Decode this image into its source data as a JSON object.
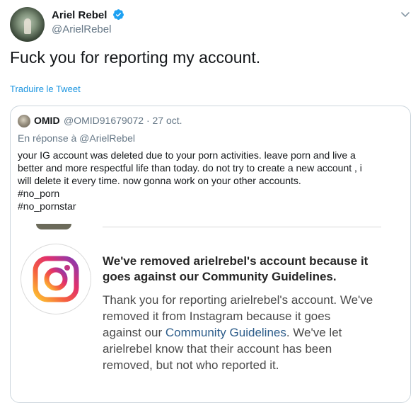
{
  "author": {
    "display_name": "Ariel Rebel",
    "handle": "@ArielRebel",
    "verified": true
  },
  "tweet": {
    "text": "Fuck you for reporting my account.",
    "translate_label": "Traduire le Tweet"
  },
  "quoted_tweet": {
    "display_name": "OMID",
    "handle_and_date": "@OMID91679072 · 27 oct.",
    "reply_to": "En réponse à @ArielRebel",
    "body_lines": [
      "your IG account was deleted due to your porn activities. leave porn and live a",
      "better and more respectful life than today. do not try to create a new account , i",
      "will delete it every time. now gonna work on your other accounts.",
      "#no_porn",
      "#no_pornstar"
    ]
  },
  "embedded_image": {
    "heading_lines": [
      "We've removed arielrebel's account because it",
      "goes against our Community Guidelines."
    ],
    "body_line_1": "Thank you for reporting arielrebel's account. We've",
    "body_line_2": "removed it from Instagram because it goes",
    "body_line_3_prefix": "against our ",
    "body_line_3_link": "Community Guidelines",
    "body_line_3_suffix": ". We've let",
    "body_line_4": "arielrebel know that their account has been",
    "body_line_5": "removed, but not who reported it."
  },
  "icons": {
    "verified": "verified-badge-icon",
    "chevron": "chevron-down-icon",
    "instagram": "instagram-logo-icon"
  },
  "colors": {
    "text": "#14171a",
    "secondary": "#657786",
    "link": "#1b95e0",
    "verified": "#1da1f2",
    "border": "#ccd6dd"
  }
}
